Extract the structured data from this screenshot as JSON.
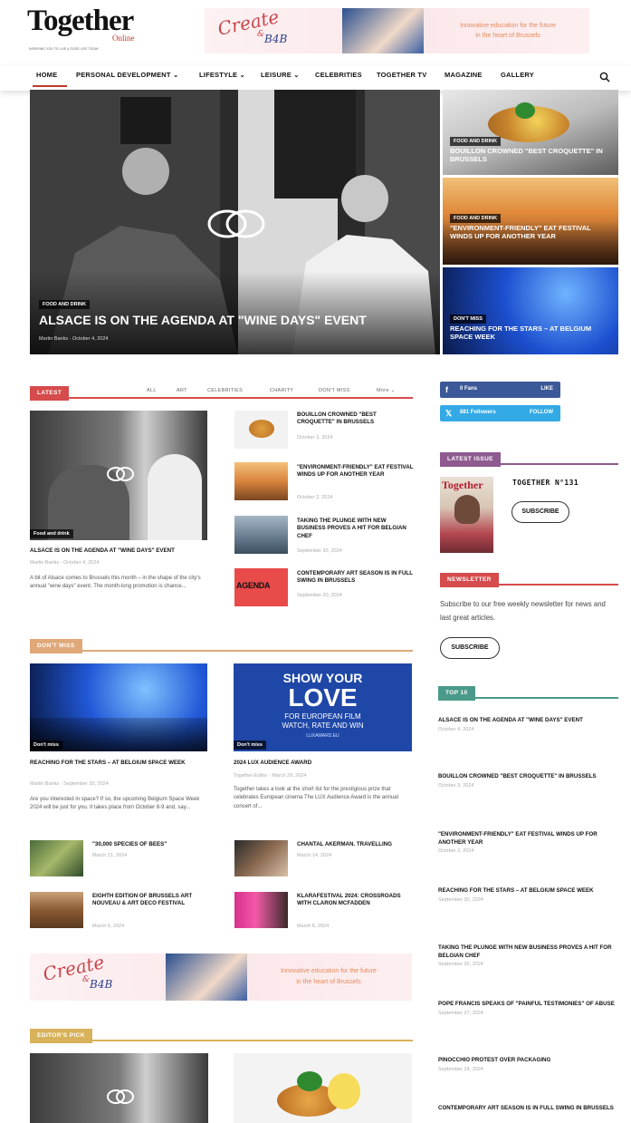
{
  "header": {
    "logo_main": "Together",
    "logo_sub": "Online",
    "tagline": "INSPIRING YOU TO LIVE A GOOD LIFE TODAY",
    "banner": {
      "script_text": "Create",
      "amp": "&",
      "brand": "B4B",
      "line1": "Innovative education for the future",
      "line2": "in the heart of Brussels"
    }
  },
  "nav": {
    "items": [
      "HOME",
      "PERSONAL DEVELOPMENT",
      "LIFESTYLE",
      "LEISURE",
      "CELEBRITIES",
      "TOGETHER TV",
      "MAGAZINE",
      "GALLERY"
    ],
    "dropdown_marker": "⌄",
    "search_icon": "search-icon",
    "active_color": "#c0392b"
  },
  "hero": {
    "main": {
      "category": "FOOD AND DRINK",
      "title": "ALSACE IS ON THE AGENDA AT \"WINE DAYS\" EVENT",
      "author": "Martin Banks",
      "date": "October 4, 2024"
    },
    "side": [
      {
        "category": "FOOD AND DRINK",
        "title": "BOUILLON CROWNED \"BEST CROQUETTE\" IN BRUSSELS"
      },
      {
        "category": "FOOD AND DRINK",
        "title": "\"ENVIRONMENT-FRIENDLY\" EAT FESTIVAL WINDS UP FOR ANOTHER YEAR"
      },
      {
        "category": "DON'T MISS",
        "title": "REACHING FOR THE STARS – AT BELGIUM SPACE WEEK"
      }
    ]
  },
  "latest": {
    "label": "LATEST",
    "accent": "#d64b4b",
    "tabs": [
      "ALL",
      "ART",
      "CELEBRITIES",
      "CHARITY",
      "DON'T MISS",
      "More"
    ],
    "main": {
      "category": "Food and drink",
      "title": "ALSACE IS ON THE AGENDA AT \"WINE DAYS\" EVENT",
      "author": "Martin Banks",
      "date": "October 4, 2024",
      "excerpt": "A bit of Alsace comes to Brussels this month – in the shape of the city's annual \"wine days\" event. The month-long promotion is chance..."
    },
    "list": [
      {
        "title": "BOUILLON CROWNED \"BEST CROQUETTE\" IN BRUSSELS",
        "date": "October 3, 2024"
      },
      {
        "title": "\"ENVIRONMENT-FRIENDLY\" EAT FESTIVAL WINDS UP FOR ANOTHER YEAR",
        "date": "October 2, 2024"
      },
      {
        "title": "TAKING THE PLUNGE WITH NEW BUSINESS PROVES A HIT FOR BELGIAN CHEF",
        "date": "September 30, 2024"
      },
      {
        "title": "CONTEMPORARY ART SEASON IS IN FULL SWING IN BRUSSELS",
        "date": "September 20, 2024",
        "thumb_text": "AGENDA"
      }
    ]
  },
  "social": {
    "facebook": {
      "count": "0",
      "unit": "Fans",
      "action": "LIKE"
    },
    "twitter": {
      "count": "881",
      "unit": "Followers",
      "action": "FOLLOW"
    }
  },
  "latest_issue": {
    "label": "LATEST ISSUE",
    "accent": "#8e5a8f",
    "cover_title": "Together",
    "issue": "TOGETHER N°131",
    "button": "SUBSCRIBE"
  },
  "newsletter": {
    "label": "NEWSLETTER",
    "accent": "#d64b4b",
    "text": "Subscribe to our free weekly newsletter for news and last great articles.",
    "button": "SUBSCRIBE"
  },
  "dont_miss": {
    "label": "DON'T MISS",
    "accent": "#e0a878",
    "left": {
      "category": "Don't miss",
      "title": "REACHING FOR THE STARS – AT BELGIUM SPACE WEEK",
      "author": "Martin Banks",
      "date": "September 30, 2024",
      "excerpt": "Are you interested in space? If so, the upcoming Belgium Space Week 2024 will be just for you. It takes place from October 8-9 and, say..."
    },
    "right": {
      "category": "Don't miss",
      "title": "2024 LUX AUDIENCE AWARD",
      "author": "Together Editor",
      "date": "March 29, 2024",
      "excerpt": "Together takes a look at the short list for the prestigious prize that celebrates European cinema The LUX Audience Award is the annual concert of...",
      "ad": {
        "l1": "SHOW YOUR",
        "l2": "LOVE",
        "l3": "FOR EUROPEAN FILM",
        "l4": "WATCH, RATE AND WIN",
        "l5": "LUXAWARD.EU"
      }
    },
    "small": [
      {
        "title": "\"30,000 SPECIES OF BEES\"",
        "date": "March 21, 2024"
      },
      {
        "title": "CHANTAL AKERMAN. TRAVELLING",
        "date": "March 14, 2024"
      },
      {
        "title": "EIGHTH EDITION OF BRUSSELS ART NOUVEAU & ART DECO FESTIVAL",
        "date": "March 5, 2024"
      },
      {
        "title": "KLARAFESTIVAL 2024: CROSSROADS WITH CLARON MCFADDEN",
        "date": "March 8, 2024"
      }
    ]
  },
  "top10": {
    "label": "TOP 10",
    "accent": "#4a9a8a",
    "items": [
      {
        "title": "ALSACE IS ON THE AGENDA AT \"WINE DAYS\" EVENT",
        "date": "October 4, 2024"
      },
      {
        "title": "BOUILLON CROWNED \"BEST CROQUETTE\" IN BRUSSELS",
        "date": "October 3, 2024"
      },
      {
        "title": "\"ENVIRONMENT-FRIENDLY\" EAT FESTIVAL WINDS UP FOR ANOTHER YEAR",
        "date": "October 2, 2024"
      },
      {
        "title": "REACHING FOR THE STARS – AT BELGIUM SPACE WEEK",
        "date": "September 30, 2024"
      },
      {
        "title": "TAKING THE PLUNGE WITH NEW BUSINESS PROVES A HIT FOR BELGIAN CHEF",
        "date": "September 30, 2024"
      },
      {
        "title": "POPE FRANCIS SPEAKS OF \"PAINFUL TESTIMONIES\" OF ABUSE",
        "date": "September 27, 2024"
      },
      {
        "title": "PINOCCHIO PROTEST OVER PACKAGING",
        "date": "September 24, 2024"
      },
      {
        "title": "CONTEMPORARY ART SEASON IS IN FULL SWING IN BRUSSELS",
        "date": ""
      }
    ]
  },
  "editors_pick": {
    "label": "EDITOR'S PICK",
    "accent": "#d8b25a"
  }
}
